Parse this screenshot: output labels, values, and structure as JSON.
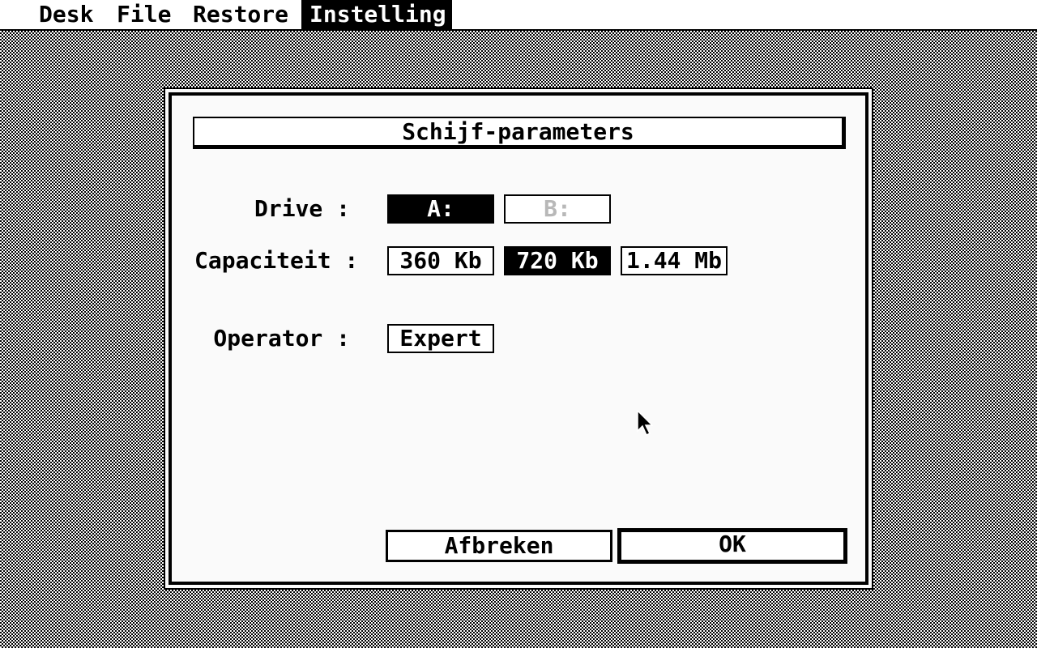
{
  "menubar": {
    "items": [
      {
        "label": "Desk"
      },
      {
        "label": "File"
      },
      {
        "label": "Restore"
      },
      {
        "label": "Instelling"
      }
    ],
    "active": "Instelling"
  },
  "dialog": {
    "title": "Schijf-parameters",
    "drive": {
      "label": "Drive :",
      "options": [
        "A:",
        "B:"
      ],
      "selected": "A:",
      "disabled": "B:"
    },
    "capacity": {
      "label": "Capaciteit :",
      "options": [
        "360 Kb",
        "720 Kb",
        "1.44 Mb"
      ],
      "selected": "720 Kb"
    },
    "operator": {
      "label": "Operator :",
      "value": "Expert"
    },
    "buttons": {
      "cancel": "Afbreken",
      "ok": "OK"
    }
  },
  "colors": {
    "foreground": "#000000",
    "background": "#ffffff",
    "disabled_text": "#b8b8b8"
  }
}
